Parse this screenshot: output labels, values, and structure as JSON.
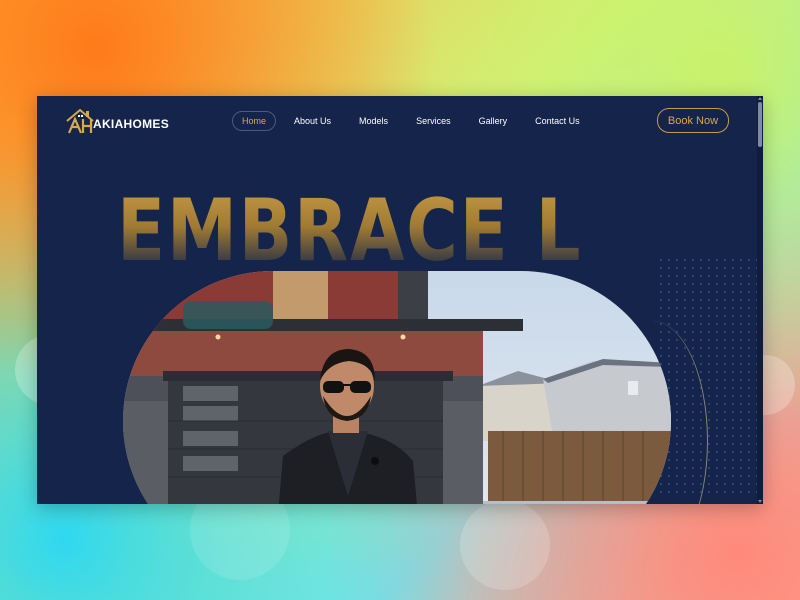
{
  "brand": {
    "name": "AKIAHOMES",
    "colors": {
      "navy": "#14244a",
      "gold": "#d9a84a"
    }
  },
  "nav": {
    "items": [
      {
        "label": "Home",
        "active": true
      },
      {
        "label": "About Us",
        "active": false
      },
      {
        "label": "Models",
        "active": false
      },
      {
        "label": "Services",
        "active": false
      },
      {
        "label": "Gallery",
        "active": false
      },
      {
        "label": "Contact Us",
        "active": false
      }
    ]
  },
  "cta": {
    "label": "Book Now"
  },
  "hero": {
    "headline": "EMBRACE LIFE"
  },
  "icons": {
    "logo": "house-logo-icon"
  }
}
